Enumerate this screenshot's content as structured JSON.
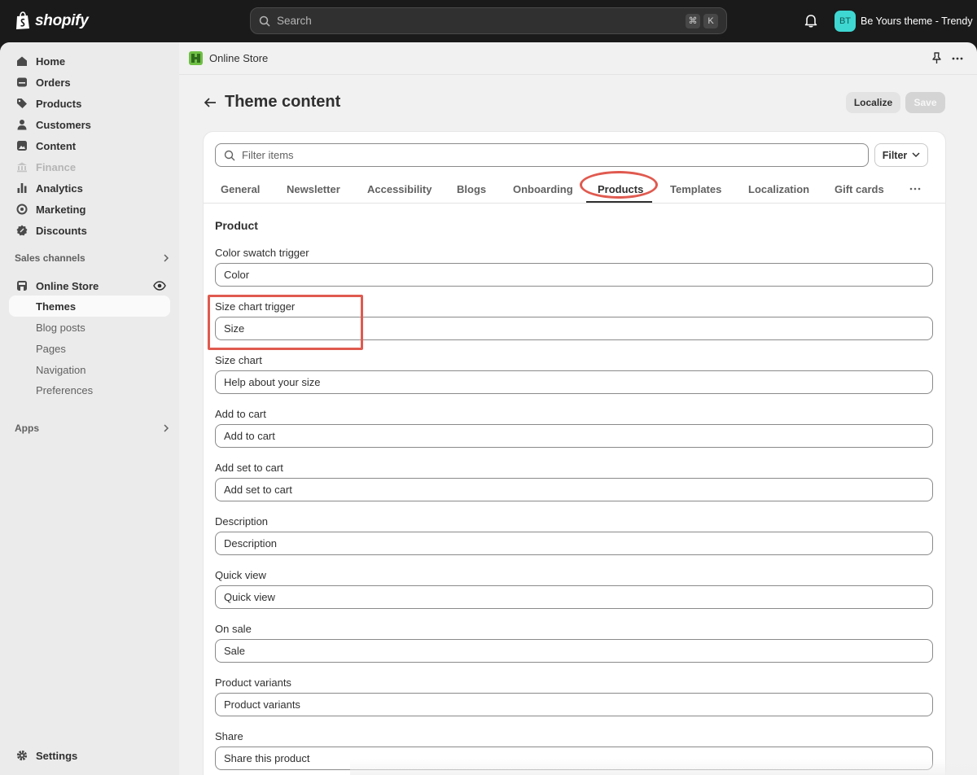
{
  "topbar": {
    "logo_text": "shopify",
    "search_placeholder": "Search",
    "shortcut_keys": [
      "⌘",
      "K"
    ],
    "store_initials": "BT",
    "store_name": "Be Yours theme - Trendy",
    "avatar_color": "#3fd7d2"
  },
  "sidebar": {
    "items": [
      {
        "label": "Home",
        "icon": "home-icon"
      },
      {
        "label": "Orders",
        "icon": "orders-icon"
      },
      {
        "label": "Products",
        "icon": "tag-icon"
      },
      {
        "label": "Customers",
        "icon": "person-icon"
      },
      {
        "label": "Content",
        "icon": "content-icon"
      },
      {
        "label": "Finance",
        "icon": "bank-icon"
      },
      {
        "label": "Analytics",
        "icon": "bar-chart-icon"
      },
      {
        "label": "Marketing",
        "icon": "target-icon"
      },
      {
        "label": "Discounts",
        "icon": "discount-icon"
      }
    ],
    "sales_channels_label": "Sales channels",
    "online_store_label": "Online Store",
    "sub_items": [
      {
        "label": "Themes"
      },
      {
        "label": "Blog posts"
      },
      {
        "label": "Pages"
      },
      {
        "label": "Navigation"
      },
      {
        "label": "Preferences"
      }
    ],
    "apps_label": "Apps",
    "settings_label": "Settings"
  },
  "header": {
    "breadcrumb": "Online Store",
    "page_title": "Theme content",
    "localize_label": "Localize",
    "save_label": "Save"
  },
  "filter": {
    "placeholder": "Filter items",
    "button_label": "Filter"
  },
  "tabs": [
    {
      "label": "General"
    },
    {
      "label": "Newsletter"
    },
    {
      "label": "Accessibility"
    },
    {
      "label": "Blogs"
    },
    {
      "label": "Onboarding"
    },
    {
      "label": "Products"
    },
    {
      "label": "Templates"
    },
    {
      "label": "Localization"
    },
    {
      "label": "Gift cards"
    }
  ],
  "active_tab": "Products",
  "section": {
    "title": "Product",
    "fields": [
      {
        "label": "Color swatch trigger",
        "value": "Color"
      },
      {
        "label": "Size chart trigger",
        "value": "Size"
      },
      {
        "label": "Size chart",
        "value": "Help about your size"
      },
      {
        "label": "Add to cart",
        "value": "Add to cart"
      },
      {
        "label": "Add set to cart",
        "value": "Add set to cart"
      },
      {
        "label": "Description",
        "value": "Description"
      },
      {
        "label": "Quick view",
        "value": "Quick view"
      },
      {
        "label": "On sale",
        "value": "Sale"
      },
      {
        "label": "Product variants",
        "value": "Product variants"
      },
      {
        "label": "Share",
        "value": "Share this product"
      }
    ]
  },
  "annotation_color": "#e05a4f"
}
